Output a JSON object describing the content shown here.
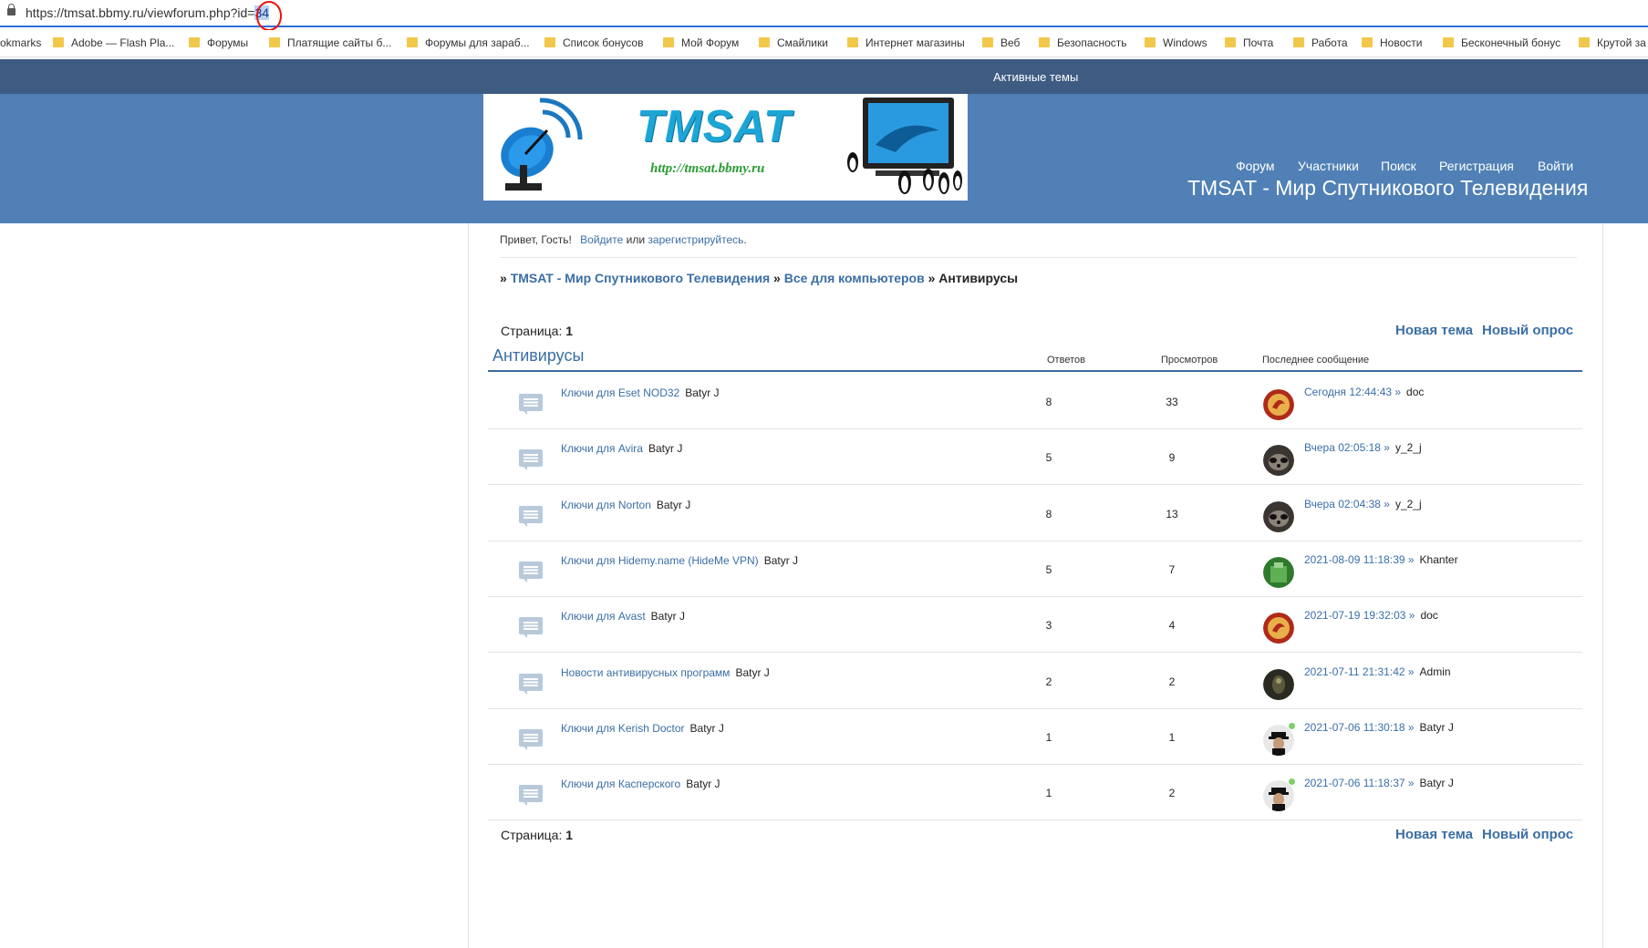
{
  "browser": {
    "url_prefix": "https://tmsat.bbmy.ru/viewforum.php?id=",
    "url_id": "34",
    "bookmarks": [
      "okmarks",
      "Adobe — Flash Pla...",
      "Форумы",
      "Платящие сайты б...",
      "Форумы для зараб...",
      "Список бонусов",
      "Мой Форум",
      "Смайлики",
      "Интернет магазины",
      "Веб",
      "Безопасность",
      "Windows",
      "Почта",
      "Работа",
      "Новости",
      "Бесконечный бонус",
      "Крутой за"
    ]
  },
  "site": {
    "active_topics": "Активные темы",
    "banner_title": "TMSAT",
    "banner_sub": "http://tmsat.bbmy.ru",
    "nav": [
      "Форум",
      "Участники",
      "Поиск",
      "Регистрация",
      "Войти"
    ],
    "name": "TMSAT - Мир Спутникового Телевидения"
  },
  "greeting": {
    "text": "Привет, Гость!",
    "login": "Войдите",
    "or": "или",
    "register": "зарегистрируйтесь",
    "dot": "."
  },
  "breadcrumb": {
    "sep": "»",
    "items": [
      "TMSAT - Мир Спутникового Телевидения",
      "Все для компьютеров"
    ],
    "current": "Антивирусы"
  },
  "paging": {
    "label": "Страница:",
    "page": "1"
  },
  "actions": {
    "new_topic": "Новая тема",
    "new_poll": "Новый опрос"
  },
  "forum": {
    "title": "Антивирусы",
    "col_replies": "Ответов",
    "col_views": "Просмотров",
    "col_last": "Последнее сообщение",
    "topics": [
      {
        "title": "Ключи для Eset NOD32",
        "author": "Batyr J",
        "replies": "8",
        "views": "33",
        "last_time": "Сегодня 12:44:43 »",
        "last_user": "doc",
        "avatar": "avatar-doc",
        "online": false
      },
      {
        "title": "Ключи для Avira",
        "author": "Batyr J",
        "replies": "5",
        "views": "9",
        "last_time": "Вчера 02:05:18 »",
        "last_user": "y_2_j",
        "avatar": "avatar-raccoon",
        "online": false
      },
      {
        "title": "Ключи для Norton",
        "author": "Batyr J",
        "replies": "8",
        "views": "13",
        "last_time": "Вчера 02:04:38 »",
        "last_user": "y_2_j",
        "avatar": "avatar-raccoon",
        "online": false
      },
      {
        "title": "Ключи для Hidemy.name (HideMe VPN)",
        "author": "Batyr J",
        "replies": "5",
        "views": "7",
        "last_time": "2021-08-09 11:18:39 »",
        "last_user": "Khanter",
        "avatar": "avatar-khanter",
        "online": false
      },
      {
        "title": "Ключи для Avast",
        "author": "Batyr J",
        "replies": "3",
        "views": "4",
        "last_time": "2021-07-19 19:32:03 »",
        "last_user": "doc",
        "avatar": "avatar-doc",
        "online": false
      },
      {
        "title": "Новости антивирусных программ",
        "author": "Batyr J",
        "replies": "2",
        "views": "2",
        "last_time": "2021-07-11 21:31:42 »",
        "last_user": "Admin",
        "avatar": "avatar-admin",
        "online": false
      },
      {
        "title": "Ключи для Kerish Doctor",
        "author": "Batyr J",
        "replies": "1",
        "views": "1",
        "last_time": "2021-07-06 11:30:18 »",
        "last_user": "Batyr J",
        "avatar": "avatar-batyr",
        "online": true
      },
      {
        "title": "Ключи для Касперского",
        "author": "Batyr J",
        "replies": "1",
        "views": "2",
        "last_time": "2021-07-06 11:18:37 »",
        "last_user": "Batyr J",
        "avatar": "avatar-batyr",
        "online": true
      }
    ]
  }
}
